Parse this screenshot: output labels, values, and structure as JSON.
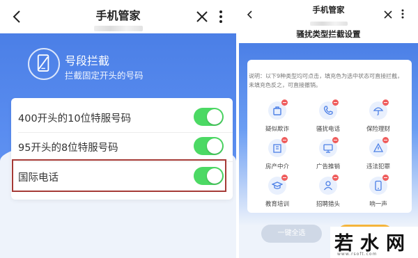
{
  "left_phone": {
    "app_title": "手机管家",
    "feature": {
      "title": "号段拦截",
      "description": "拦截固定开头的号码"
    },
    "settings": [
      {
        "label": "400开头的10位特服号码",
        "enabled": true
      },
      {
        "label": "95开头的8位特服号码",
        "enabled": true
      },
      {
        "label": "国际电话",
        "enabled": true
      }
    ],
    "colors": {
      "accent": "#4b7fe6",
      "toggle_on": "#4cd964",
      "highlight_border": "#a53a36"
    }
  },
  "right_phone": {
    "app_title": "手机管家",
    "page_title": "骚扰类型拦截设置",
    "note": "说明：以下9种类型均可点击，填充色为选中状态可直接拦截，未填充色反之，可直接撤销。",
    "categories": [
      {
        "label": "疑似欺诈",
        "icon": "bag-icon"
      },
      {
        "label": "骚扰电话",
        "icon": "phone-icon"
      },
      {
        "label": "保险理财",
        "icon": "umbrella-icon"
      },
      {
        "label": "房产中介",
        "icon": "building-icon"
      },
      {
        "label": "广告推销",
        "icon": "ad-icon"
      },
      {
        "label": "违法犯罪",
        "icon": "warning-icon"
      },
      {
        "label": "教育培训",
        "icon": "graduation-icon"
      },
      {
        "label": "招聘猎头",
        "icon": "person-icon"
      },
      {
        "label": "响一声",
        "icon": "mobile-icon"
      }
    ],
    "select_all_label": "一键全选",
    "colors": {
      "badge": "#ef5d5d",
      "action_button": "#f5b43a"
    }
  },
  "watermark": {
    "text": "若水网",
    "url": "www.rsoft.com"
  }
}
